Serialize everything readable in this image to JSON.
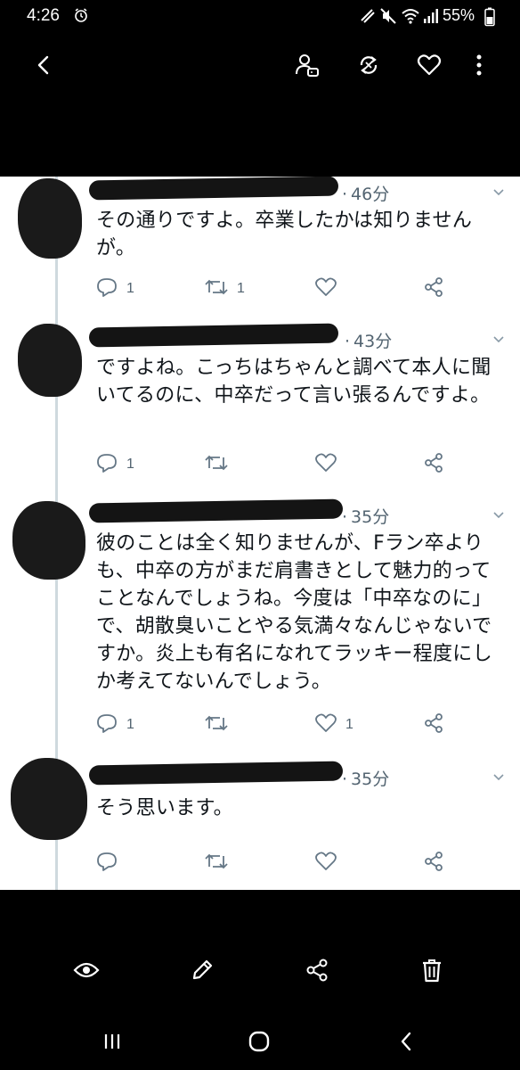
{
  "status_bar": {
    "time": "4:26",
    "battery": "55%",
    "icons": [
      "alarm-icon",
      "no-signal-icon",
      "mute-icon",
      "wifi-icon",
      "signal-icon",
      "battery-icon"
    ]
  },
  "viewer_toolbar": {
    "icons": [
      "back-icon",
      "tag-person-icon",
      "rotate-icon",
      "favorite-icon",
      "more-icon"
    ]
  },
  "tweets": [
    {
      "time": "46分",
      "text": "その通りですよ。卒業したかは知りませんが。",
      "reply_count": "1",
      "retweet_count": "1",
      "like_count": ""
    },
    {
      "time": "43分",
      "text": "ですよね。こっちはちゃんと調べて本人に聞いてるのに、中卒だって言い張るんですよ。",
      "reply_count": "1",
      "retweet_count": "",
      "like_count": ""
    },
    {
      "time": "35分",
      "text": "彼のことは全く知りませんが、Fラン卒よりも、中卒の方がまだ肩書きとして魅力的ってことなんでしょうね。今度は「中卒なのに」で、胡散臭いことやる気満々なんじゃないですか。炎上も有名になれてラッキー程度にしか考えてないんでしょう。",
      "reply_count": "1",
      "retweet_count": "",
      "like_count": "1"
    },
    {
      "time": "35分",
      "text": "そう思います。",
      "reply_count": "",
      "retweet_count": "",
      "like_count": ""
    }
  ],
  "bottom_toolbar": {
    "icons": [
      "view-icon",
      "edit-icon",
      "share-icon",
      "delete-icon"
    ]
  },
  "nav_bar": {
    "icons": [
      "recents-icon",
      "home-icon",
      "back-nav-icon"
    ]
  },
  "colors": {
    "background": "#000000",
    "tweet_background": "#ffffff",
    "tweet_text": "#0f1419",
    "secondary_text": "#536471",
    "thread_line": "#cfd9de"
  }
}
